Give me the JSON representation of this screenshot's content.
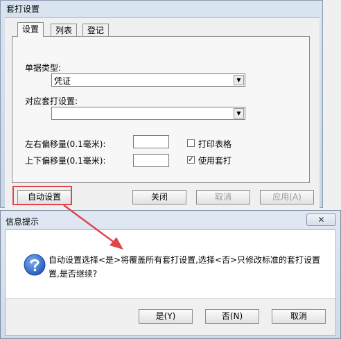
{
  "window": {
    "title": "套打设置",
    "tabs": [
      "设置",
      "列表",
      "登记"
    ],
    "labels": {
      "doc_type": "单据类型:",
      "print_setting": "对应套打设置:",
      "lr_offset": "左右偏移量(0.1毫米):",
      "ud_offset": "上下偏移量(0.1毫米):"
    },
    "doc_type_value": "凭证",
    "print_setting_value": "",
    "checkboxes": {
      "print_table": {
        "label": "打印表格",
        "checked": false
      },
      "use_template": {
        "label": "使用套打",
        "checked": true
      }
    },
    "check_mark": "✓",
    "dropdown_arrow": "▼",
    "buttons": {
      "auto": "自动设置",
      "close": "关闭",
      "cancel": "取消",
      "apply": "应用(A)"
    }
  },
  "dialog": {
    "title": "信息提示",
    "close_label": "✕",
    "message_line1": "自动设置选择<是>将覆盖所有套打设置,选择<否>只修改标准的套打设置",
    "message_line2": "置,是否继续?",
    "buttons": {
      "yes": "是(Y)",
      "no": "否(N)",
      "cancel": "取消"
    }
  },
  "colors": {
    "annotation": "#e0454a",
    "icon_blue": "#2a63c4"
  }
}
